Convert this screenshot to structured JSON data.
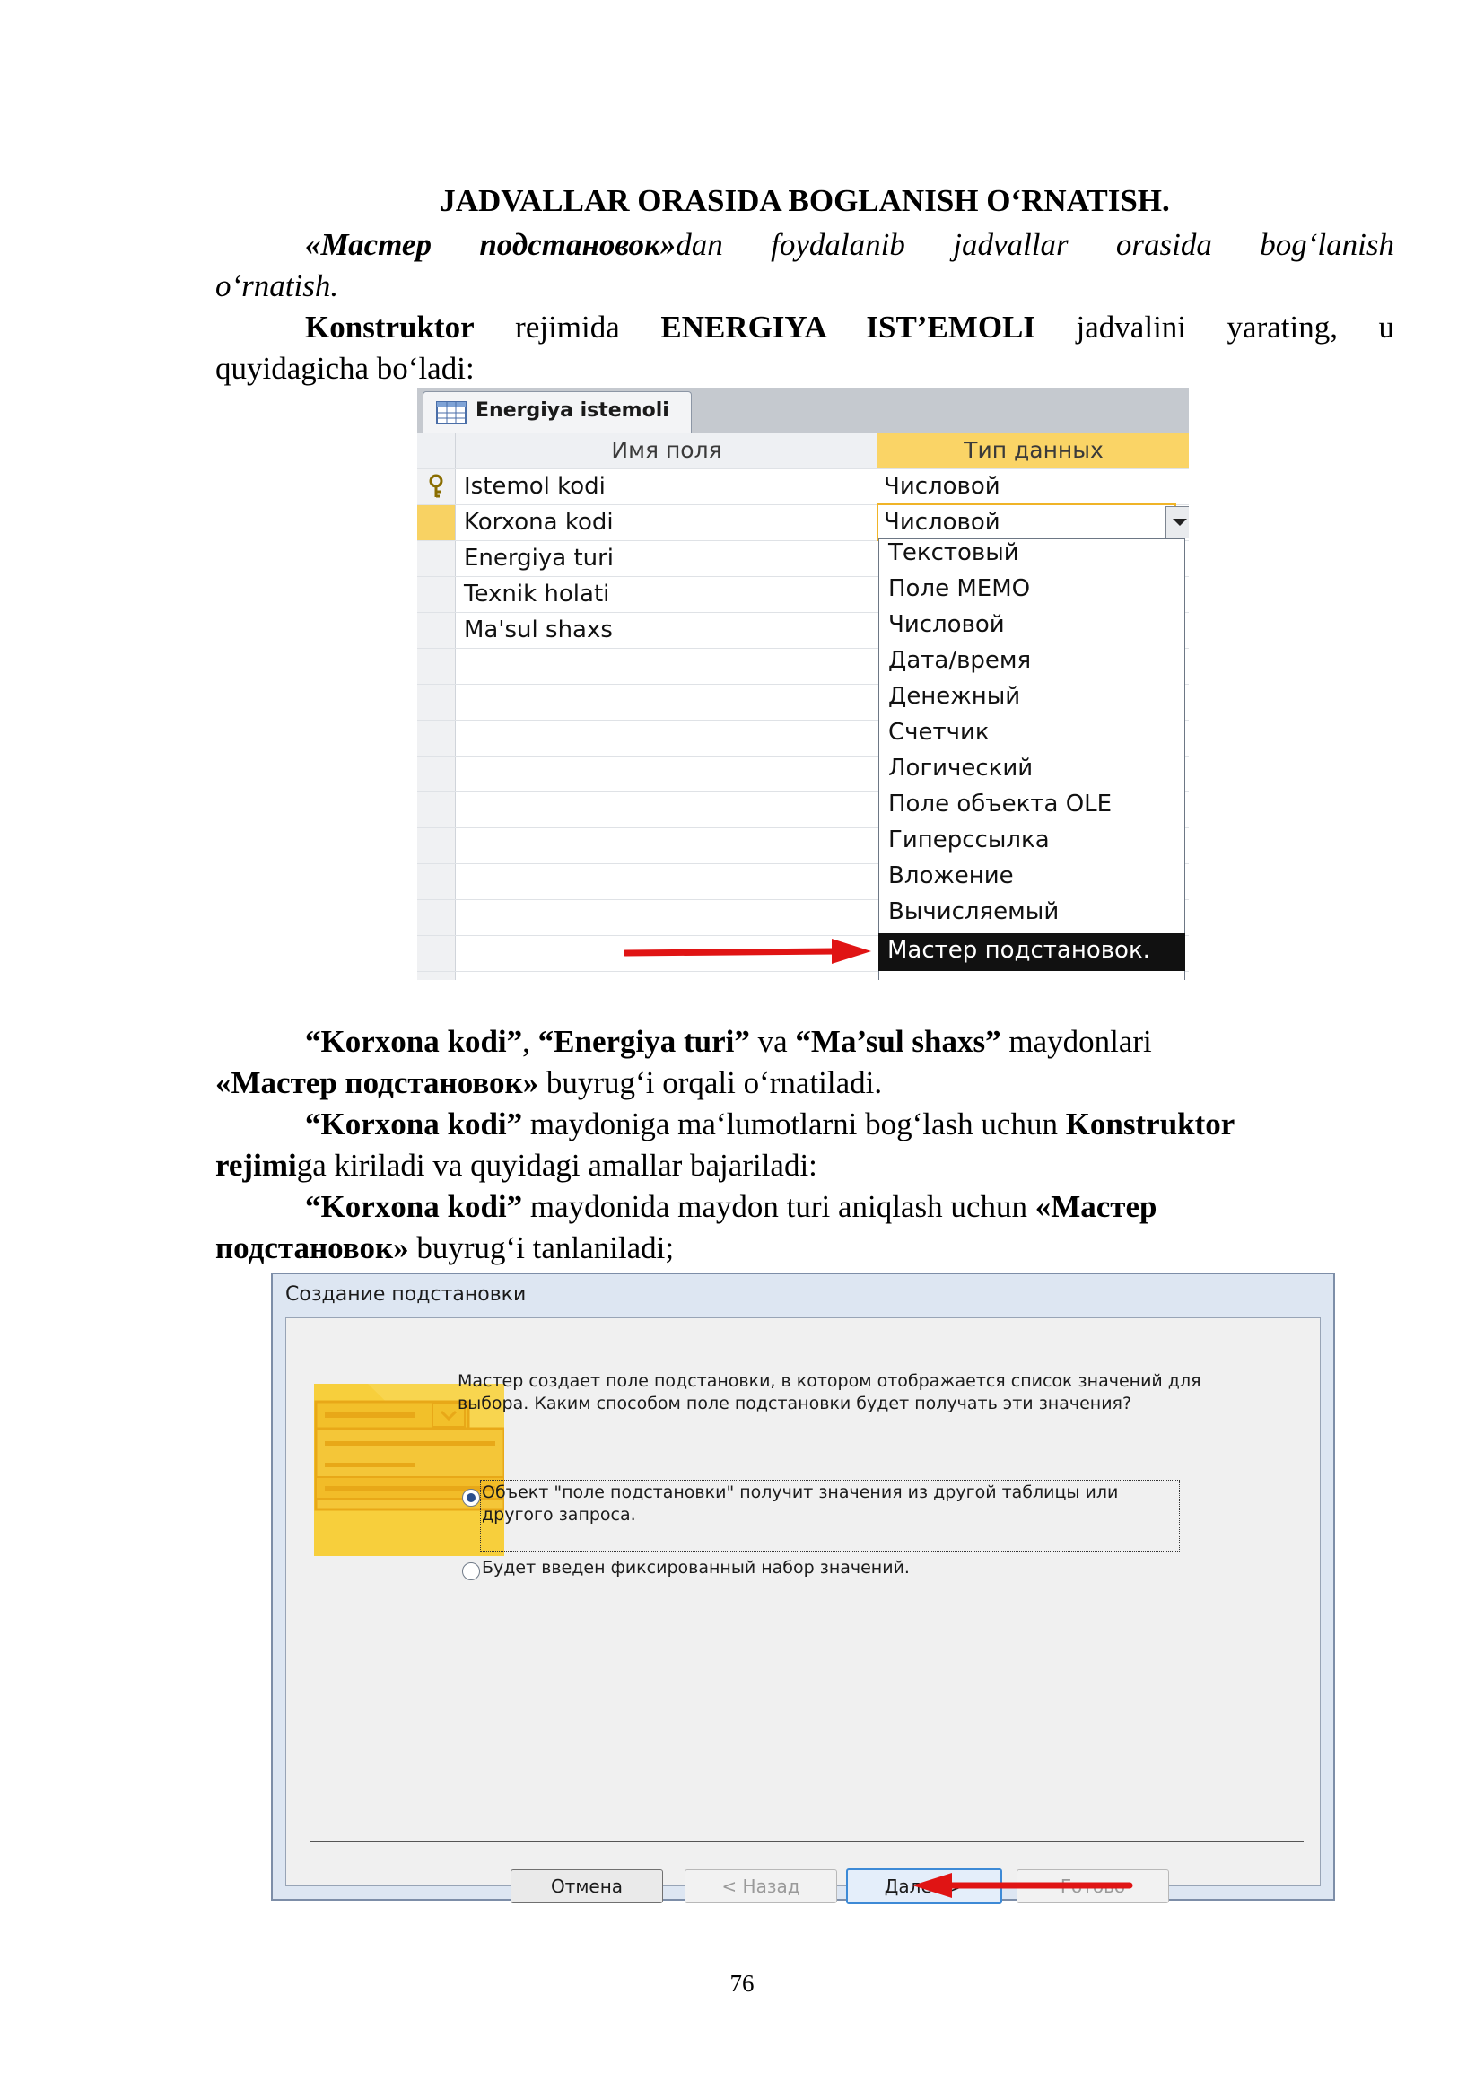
{
  "title": "JADVALLAR ORASIDA BOGLANISH OʻRNATISH.",
  "intro": {
    "line1_italic_bold": "«Мастер подстановок»",
    "line1_rest": "dan foydalanib jadvallar orasida bogʻlanish",
    "line2": "oʻrnatish."
  },
  "para1": {
    "b1": "Konstruktor",
    "t1": " rejimida ",
    "b2": "ENERGIYA IST’EMOLI",
    "t2": " jadvalini yarating, u",
    "line2": "quyidagicha boʻladi:"
  },
  "access_table": {
    "tab_label": "Energiya istemoli",
    "col_name": "Имя поля",
    "col_type": "Тип данных",
    "rows": [
      {
        "name": "Istemol kodi",
        "type": "Числовой"
      },
      {
        "name": "Korxona kodi",
        "type": "Числовой"
      },
      {
        "name": "Energiya turi",
        "type": ""
      },
      {
        "name": "Texnik holati",
        "type": ""
      },
      {
        "name": "Ma'sul shaxs",
        "type": ""
      }
    ],
    "dropdown_items": [
      "Текстовый",
      "Поле MEMO",
      "Числовой",
      "Дата/время",
      "Денежный",
      "Счетчик",
      "Логический",
      "Поле объекта OLE",
      "Гиперссылка",
      "Вложение",
      "Вычисляемый"
    ],
    "dropdown_selected": "Мастер подстановок."
  },
  "para2": {
    "q1": "“Korxona kodi”",
    "c1": ", ",
    "q2": "“Energiya  turi”",
    "c2": " va ",
    "q3": "“Ma’sul shaxs”",
    "c3": " maydonlari",
    "line2_bold": "«Мастер подстановок»",
    "line2_rest": " buyrugʻi orqali oʻrnatiladi."
  },
  "para3": {
    "b1": "“Korxona kodi”",
    "t1": " maydoniga maʻlumotlarni bogʻlash uchun ",
    "b2": "Konstruktor",
    "line2_bold": "rejimi",
    "line2_rest": "ga kiriladi va quyidagi amallar bajariladi:"
  },
  "para4": {
    "b1": "“Korxona kodi”",
    "t1": " maydonida maydon turi aniqlash uchun ",
    "b2": "«Мастер",
    "line2_bold": "подстановок»",
    "line2_rest": " buyrugʻi tanlaniladi;"
  },
  "wizard": {
    "title": "Создание подстановки",
    "description": "Мастер создает поле подстановки, в котором отображается список значений для выбора.  Каким способом поле подстановки будет получать эти значения?",
    "option1": "Объект \"поле подстановки\" получит значения из другой таблицы или другого запроса.",
    "option2": "Будет введен фиксированный набор значений.",
    "selected_option": 1,
    "buttons": {
      "cancel": "Отмена",
      "back": "< Назад",
      "next": "Далее >",
      "finish": "Готово"
    }
  },
  "page_number": "76"
}
